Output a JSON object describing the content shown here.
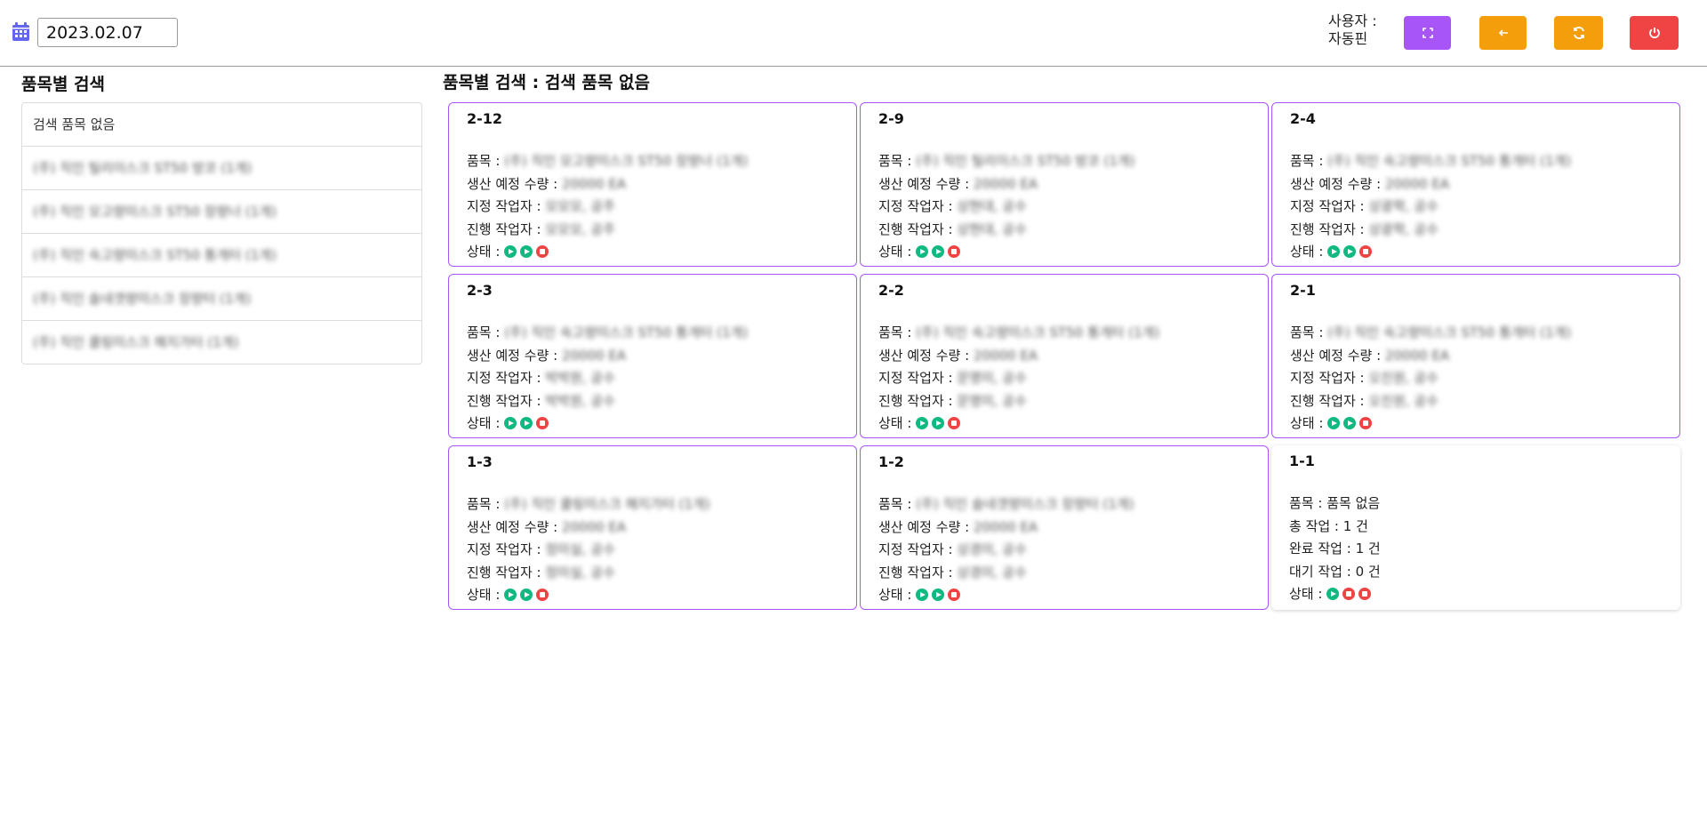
{
  "header": {
    "date_value": "2023.02.07",
    "user_label": "사용자 :",
    "user_name": "자동핀"
  },
  "sidebar": {
    "title": "품목별 검색",
    "items": [
      {
        "label": "검색 품목 없음",
        "blurred": false
      },
      {
        "label": "(주) 직인 틸리이스크 ST50 방코 (1개)",
        "blurred": true
      },
      {
        "label": "(주) 직인 모고량미스크 ST50 장량너 (1개)",
        "blurred": true
      },
      {
        "label": "(주) 직인 숙고량미스크 ST50 통개터 (1개)",
        "blurred": true
      },
      {
        "label": "(주) 직인 솔네갯량미스크 장량터 (1개)",
        "blurred": true
      },
      {
        "label": "(주) 직인 쿨링미스크 해지가터 (1개)",
        "blurred": true
      }
    ]
  },
  "main": {
    "title": "품목별 검색 : 검색 품목 없음",
    "labels": {
      "item": "품목 : ",
      "qty": "생산 예정 수량 : ",
      "assigned": "지정 작업자 : ",
      "progress": "진행 작업자 : ",
      "status": "상태 : ",
      "total": "총 작업 : ",
      "done": "완료 작업 : ",
      "waiting": "대기 작업 : "
    },
    "cards": [
      {
        "title": "2-12",
        "item": "(주) 직인 모고량미스크 ST50 장량너 (1개)",
        "qty": "20000 EA",
        "assigned": "모모모, 공주",
        "progress": "모모모, 공주",
        "status": [
          "play",
          "play",
          "stop"
        ]
      },
      {
        "title": "2-9",
        "item": "(주) 직인 틸리이스크 ST50 방코 (1개)",
        "qty": "20000 EA",
        "assigned": "상현대, 공수",
        "progress": "상현대, 공수",
        "status": [
          "play",
          "play",
          "stop"
        ]
      },
      {
        "title": "2-4",
        "item": "(주) 직인 숙고량미스크 ST50 통개터 (1개)",
        "qty": "20000 EA",
        "assigned": "상광학, 공수",
        "progress": "상광학, 공수",
        "status": [
          "play",
          "play",
          "stop"
        ]
      },
      {
        "title": "2-3",
        "item": "(주) 직인 숙고량미스크 ST50 통개터 (1개)",
        "qty": "20000 EA",
        "assigned": "박박원, 공수",
        "progress": "박박원, 공수",
        "status": [
          "play",
          "play",
          "stop"
        ]
      },
      {
        "title": "2-2",
        "item": "(주) 직인 숙고량미스크 ST50 통개터 (1개)",
        "qty": "20000 EA",
        "assigned": "문명미, 공수",
        "progress": "문명미, 공수",
        "status": [
          "play",
          "play",
          "stop"
        ]
      },
      {
        "title": "2-1",
        "item": "(주) 직인 숙고량미스크 ST50 통개터 (1개)",
        "qty": "20000 EA",
        "assigned": "오진원, 공수",
        "progress": "오진원, 공수",
        "status": [
          "play",
          "play",
          "stop"
        ]
      },
      {
        "title": "1-3",
        "item": "(주) 직인 쿨링미스크 해지가터 (1개)",
        "qty": "20000 EA",
        "assigned": "정미실, 공수",
        "progress": "정미실, 공수",
        "status": [
          "play",
          "play",
          "stop"
        ]
      },
      {
        "title": "1-2",
        "item": "(주) 직인 솔네갯량미스크 장량터 (1개)",
        "qty": "20000 EA",
        "assigned": "상경미, 공수",
        "progress": "상경미, 공수",
        "status": [
          "play",
          "play",
          "stop"
        ]
      }
    ],
    "summary_card": {
      "title": "1-1",
      "item": "품목 없음",
      "total": "1 건",
      "done": "1 건",
      "waiting": "0 건",
      "status": [
        "play",
        "stop",
        "stop"
      ]
    }
  },
  "colors": {
    "purple": "#a855f7",
    "orange": "#f59e0b",
    "red": "#ef4444",
    "green": "#10b981",
    "calendar": "#6366f1"
  },
  "icons": [
    "calendar-icon",
    "fullscreen-icon",
    "arrow-left-icon",
    "refresh-icon",
    "power-icon",
    "play-icon",
    "stop-icon"
  ]
}
